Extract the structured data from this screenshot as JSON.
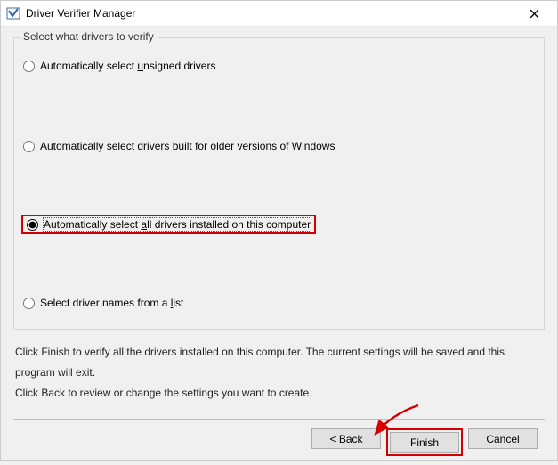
{
  "window": {
    "title": "Driver Verifier Manager"
  },
  "group": {
    "legend": "Select what drivers to verify"
  },
  "options": {
    "opt1": {
      "prefix": "Automatically select ",
      "hotkey": "u",
      "suffix": "nsigned drivers"
    },
    "opt2": {
      "prefix": "Automatically select drivers built for ",
      "hotkey": "o",
      "suffix": "lder versions of Windows"
    },
    "opt3": {
      "prefix": "Automatically select ",
      "hotkey": "a",
      "suffix": "ll drivers installed on this computer"
    },
    "opt4": {
      "prefix": "Select driver names from a ",
      "hotkey": "l",
      "suffix": "ist"
    }
  },
  "description": {
    "line1": "Click Finish to verify all the drivers installed on this computer. The current settings will be saved and this program will exit.",
    "line2": "Click Back to review or change the settings you want to create."
  },
  "buttons": {
    "back": "< Back",
    "finish": "Finish",
    "cancel": "Cancel"
  }
}
